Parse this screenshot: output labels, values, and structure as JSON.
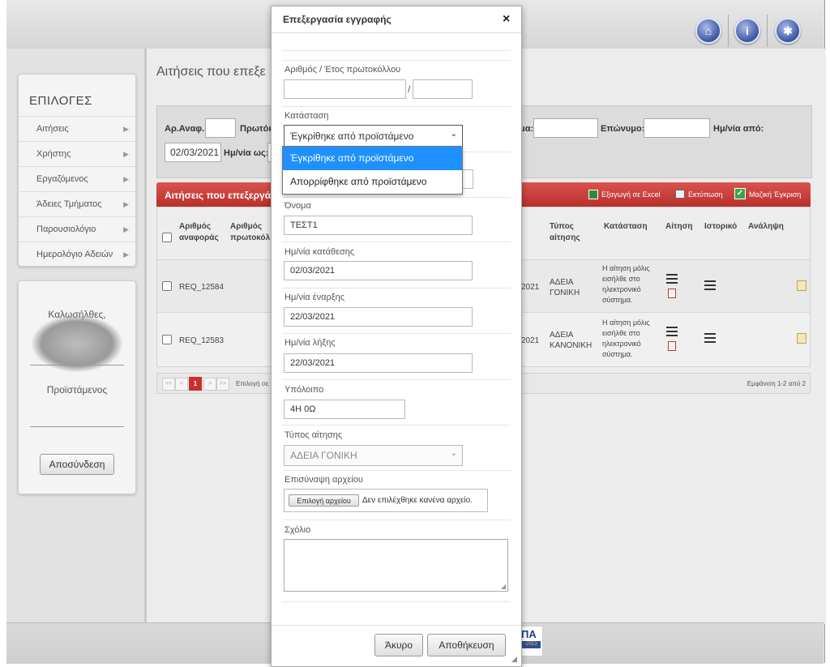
{
  "topbar": {
    "icons": [
      "home-icon",
      "info-icon",
      "settings-icon"
    ]
  },
  "sidebar": {
    "title": "ΕΠΙΛΟΓΕΣ",
    "items": [
      {
        "label": "Αιτήσεις"
      },
      {
        "label": "Χρήστης"
      },
      {
        "label": "Εργαζόμενος"
      },
      {
        "label": "Άδειες Τμήματος"
      },
      {
        "label": "Παρουσιολόγιο"
      },
      {
        "label": "Ημερολόγιο Αδειών"
      }
    ]
  },
  "user_panel": {
    "greeting": "Καλωσήλθες,",
    "role": "Προϊστάμενος",
    "logout_label": "Αποσύνδεση"
  },
  "main": {
    "title": "Αιτήσεις που επεξε",
    "filters": {
      "ref_label": "Αρ.Αναφ.:",
      "protocol_label": "Πρωτόκ",
      "name_label": "μα:",
      "surname_label": "Επώνυμο:",
      "date_from_label": "Ημ/νία από:",
      "date_from_value": "02/03/2021",
      "date_to_label": "Ημ/νία ως:"
    },
    "section_title": "Αιτήσεις που επεξεργά",
    "actions": {
      "excel": "Εξαγωγή σε Excel",
      "print": "Εκτύπωση",
      "bulk": "Μαζική Έγκριση"
    },
    "table": {
      "headers": [
        "Αριθμός αναφοράς",
        "Αριθμός πρωτοκόλ",
        "Τύπος αίτησης",
        "Κατάσταση",
        "Αίτηση",
        "Ιστορικό",
        "Ανάληψη"
      ],
      "rows": [
        {
          "ref": "REQ_12584",
          "year_tail": "2021",
          "type": "ΑΔΕΙΑ ΓΟΝΙΚΗ",
          "status": "Η αίτηση μόλις εισήλθε στο ηλεκτρονικό σύστημα."
        },
        {
          "ref": "REQ_12583",
          "year_tail": "2021",
          "type": "ΑΔΕΙΑ ΚΑΝΟΝΙΚΗ",
          "status": "Η αίτηση μόλις εισήλθε στο ηλεκτρονικό σύστημα."
        }
      ]
    },
    "pagination": {
      "first": "<<",
      "prev": "<",
      "current": "1",
      "next": ">",
      "last": ">>",
      "selection_text": "Επιλογή σε",
      "showing": "Εμφάνιση 1-2 από 2"
    }
  },
  "footer": {
    "logo_text": "ΠΑ",
    "logo_sub": "-2013"
  },
  "modal": {
    "title": "Επεξεργασία εγγραφής",
    "close": "×",
    "protocol_label": "Αριθμός / Έτος πρωτοκόλλου",
    "protocol_sep": "/",
    "status_label": "Κατάσταση",
    "status_value": "Έγκρίθηκε από προϊστάμενο",
    "status_options": [
      "Έγκρίθηκε από προϊστάμενο",
      "Απορρίφθηκε από προϊστάμενο"
    ],
    "name_label": "Όνομα",
    "name_value": "ΤΕΣΤ1",
    "submit_date_label": "Ημ/νία κατάθεσης",
    "submit_date_value": "02/03/2021",
    "start_date_label": "Ημ/νία έναρξης",
    "start_date_value": "22/03/2021",
    "end_date_label": "Ημ/νία λήξης",
    "end_date_value": "22/03/2021",
    "balance_label": "Υπόλοιπο",
    "balance_value": "4Η 0Ω",
    "type_label": "Τύπος αίτησης",
    "type_value": "ΑΔΕΙΑ ΓΟΝΙΚΗ",
    "attach_label": "Επισύναψη αρχείου",
    "attach_button": "Επιλογή αρχείου",
    "attach_status": "Δεν επιλέχθηκε κανένα αρχείο.",
    "comment_label": "Σχόλιο",
    "cancel_label": "Άκυρο",
    "save_label": "Αποθήκευση"
  },
  "colors": {
    "accent_red": "#c9302c",
    "select_blue": "#1e90ff"
  }
}
